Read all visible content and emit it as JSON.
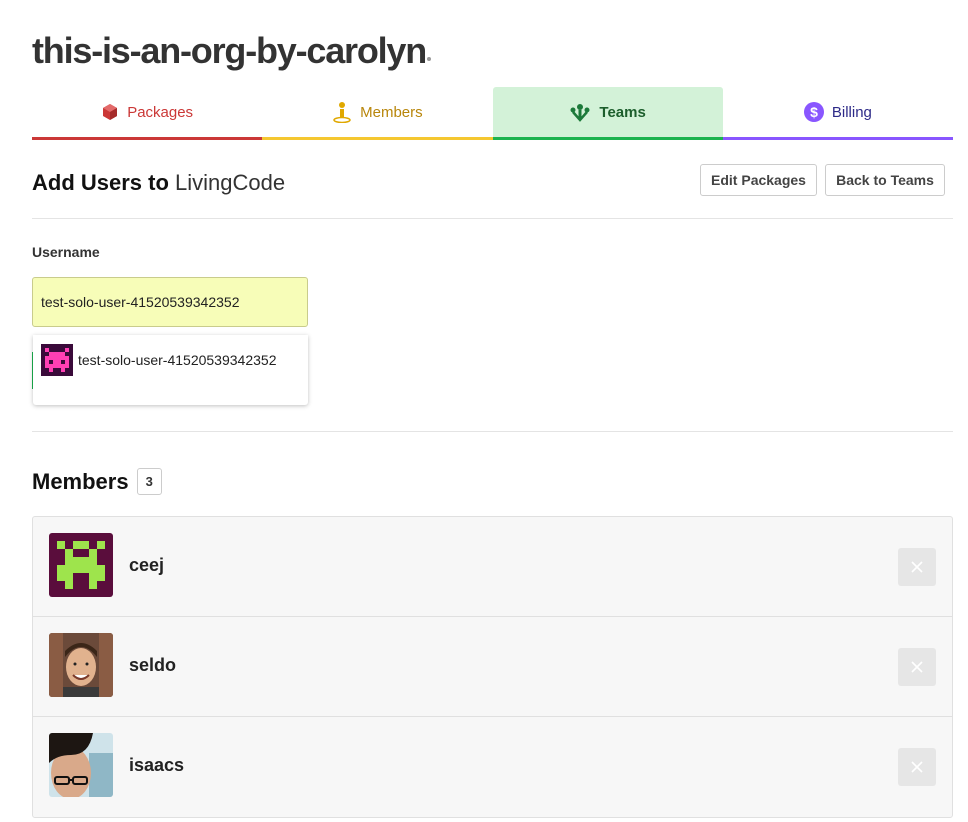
{
  "org": {
    "name": "this-is-an-org-by-carolyn"
  },
  "tabs": [
    {
      "label": "Packages",
      "icon": "package-icon",
      "color": "#cb3837"
    },
    {
      "label": "Members",
      "icon": "person-icon",
      "color": "#f5c730"
    },
    {
      "label": "Teams",
      "icon": "team-icon",
      "color": "#1cb34f",
      "active": true
    },
    {
      "label": "Billing",
      "icon": "dollar-icon",
      "color": "#8956ff"
    }
  ],
  "add_section": {
    "title_prefix": "Add Users to",
    "team_name": "LivingCode",
    "edit_packages_label": "Edit Packages",
    "back_to_teams_label": "Back to Teams"
  },
  "username_field": {
    "label": "Username",
    "value": "test-solo-user-41520539342352"
  },
  "suggestions": [
    {
      "username": "test-solo-user-41520539342352",
      "avatar": "identicon-magenta"
    }
  ],
  "members": {
    "title": "Members",
    "count": "3",
    "list": [
      {
        "username": "ceej",
        "avatar": "identicon-green"
      },
      {
        "username": "seldo",
        "avatar": "photo-avatar"
      },
      {
        "username": "isaacs",
        "avatar": "photo-avatar"
      }
    ]
  },
  "colors": {
    "input_bg": "#f7fdb8",
    "active_tab_bg": "#d3f2d8",
    "accent_red": "#cb3837"
  }
}
